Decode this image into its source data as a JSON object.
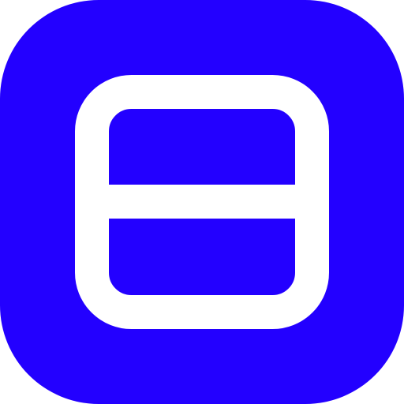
{
  "icon": {
    "name": "split-horizontal-icon",
    "background_color": "#2300FF",
    "glyph_color": "#FFFFFF"
  }
}
